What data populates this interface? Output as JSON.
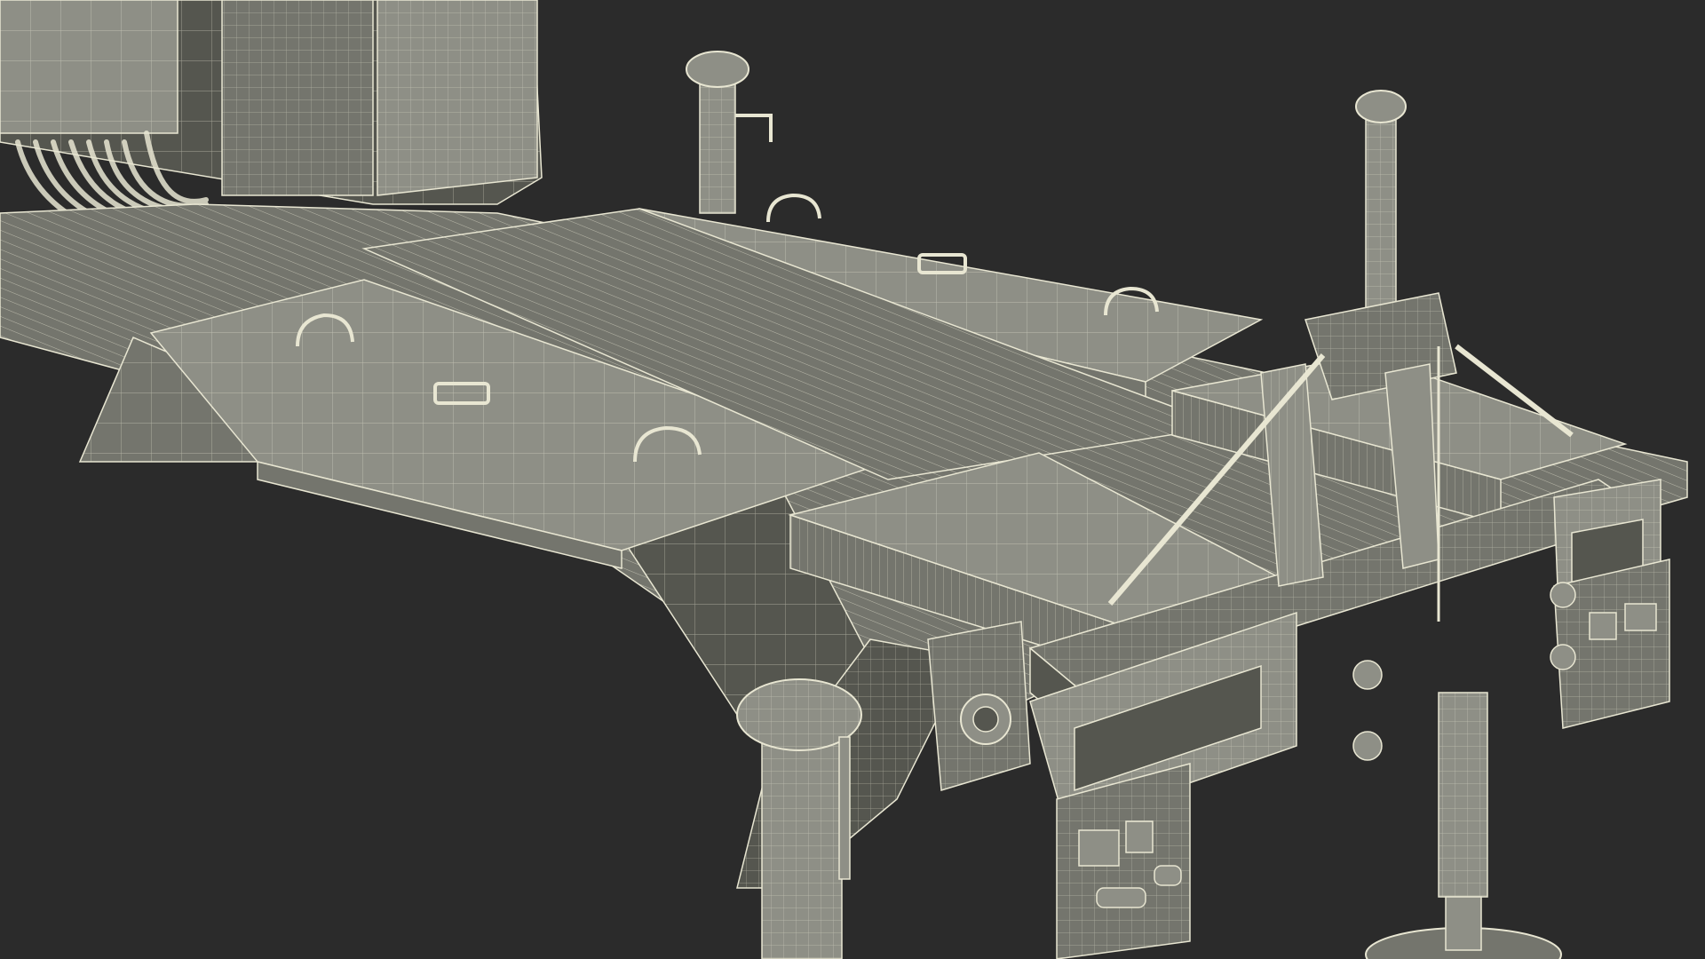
{
  "scene": {
    "subject": "",
    "render_style": "wireframe-over-shaded",
    "colors": {
      "background": "#2b2b2b",
      "surface_light": "#8e8f86",
      "surface_mid": "#74756d",
      "surface_dark": "#55564f",
      "wire": "#e8e6d2"
    }
  }
}
